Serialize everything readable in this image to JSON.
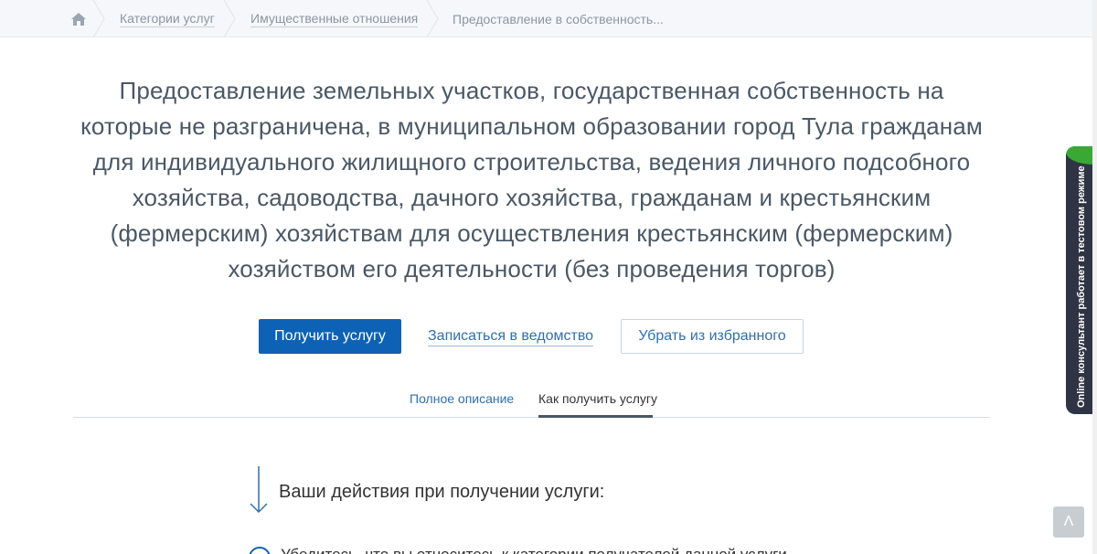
{
  "breadcrumb": {
    "items": [
      {
        "label": "Категории услуг"
      },
      {
        "label": "Имущественные отношения"
      },
      {
        "label": "Предоставление в собственность..."
      }
    ]
  },
  "service": {
    "title": "Предоставление земельных участков, государственная собственность на которые не разграничена, в муниципальном образовании город Тула гражданам для индивидуального жилищного строительства, ведения личного подсобного хозяйства, садоводства, дачного хозяйства, гражданам и крестьянским (фермерским) хозяйствам для осуществления крестьянским (фермерским) хозяйством его деятельности (без проведения торгов)"
  },
  "actions": {
    "get_service": "Получить услугу",
    "book_department": "Записаться в ведомство",
    "remove_favorite": "Убрать из избранного"
  },
  "tabs": [
    {
      "label": "Полное описание",
      "active": false
    },
    {
      "label": "Как получить услугу",
      "active": true
    }
  ],
  "steps": {
    "heading": "Ваши действия при получении услуги:",
    "first": "Убедитесь, что вы относитесь к категории получателей данной услуги"
  },
  "consultant": {
    "label": "Online консультант работает в тестовом режиме"
  },
  "scroll_top": {
    "glyph": "Λ"
  },
  "colors": {
    "primary": "#0d62b5",
    "link": "#2f6fb0",
    "consultant_bg": "#2f3445",
    "consultant_accent": "#3aa835"
  }
}
